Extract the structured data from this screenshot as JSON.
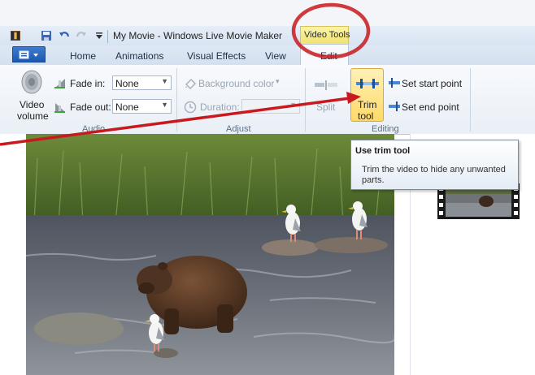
{
  "app": {
    "title": "My Movie - Windows Live Movie Maker",
    "context_tab": "Video Tools"
  },
  "tabs": [
    "Home",
    "Animations",
    "Visual Effects",
    "View",
    "Edit"
  ],
  "ribbon": {
    "audio": {
      "group_label": "Audio",
      "video_volume_line1": "Video",
      "video_volume_line2": "volume",
      "fade_in_label": "Fade in:",
      "fade_in_value": "None",
      "fade_out_label": "Fade out:",
      "fade_out_value": "None"
    },
    "adjust": {
      "group_label": "Adjust",
      "background_color": "Background color",
      "duration_label": "Duration:"
    },
    "editing": {
      "group_label": "Editing",
      "split": "Split",
      "trim_line1": "Trim",
      "trim_line2": "tool",
      "set_start": "Set start point",
      "set_end": "Set end point"
    }
  },
  "tooltip": {
    "title": "Use trim tool",
    "body": "Trim the video to hide any unwanted parts."
  },
  "colors": {
    "annotation_red": "#c8191e",
    "highlight_yellow": "#f5e27a",
    "file_button_blue": "#2a63bf"
  }
}
